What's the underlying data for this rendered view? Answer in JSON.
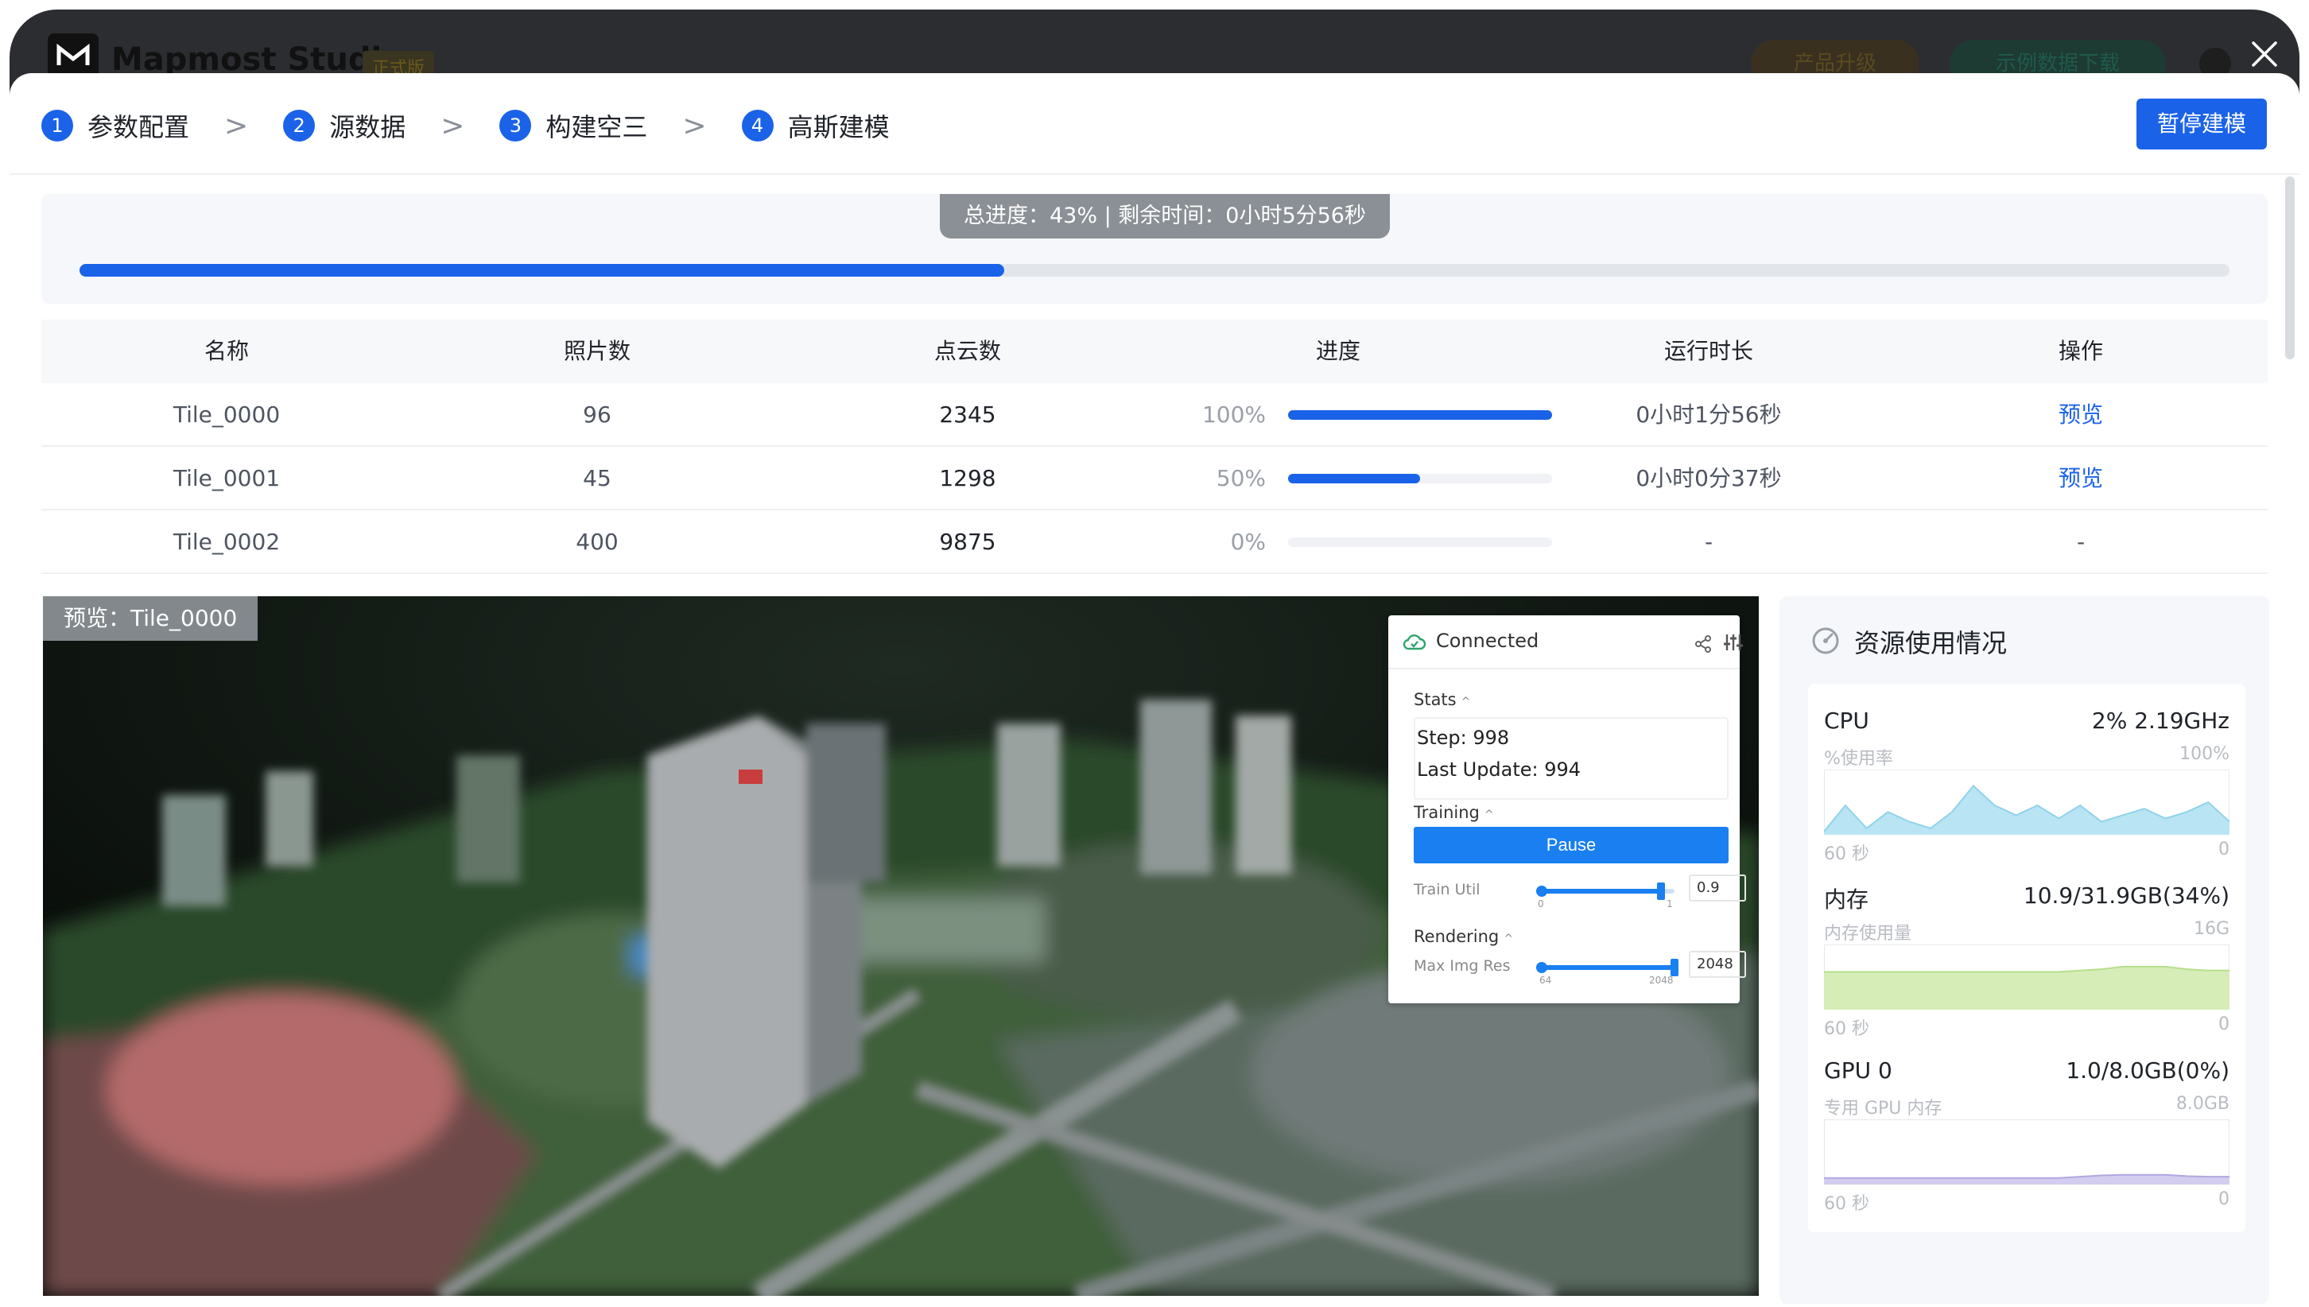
{
  "app": {
    "name": "Mapmost Studio",
    "edition_badge": "正式版",
    "upgrade_label": "产品升级",
    "sample_label": "示例数据下载"
  },
  "steps": [
    {
      "num": "1",
      "label": "参数配置"
    },
    {
      "num": "2",
      "label": "源数据"
    },
    {
      "num": "3",
      "label": "构建空三"
    },
    {
      "num": "4",
      "label": "高斯建模"
    }
  ],
  "step_separator": ">",
  "pause_button": "暂停建模",
  "progress": {
    "label": "总进度：43% | 剩余时间：0小时5分56秒",
    "fraction": 0.43
  },
  "table": {
    "headers": [
      "名称",
      "照片数",
      "点云数",
      "进度",
      "运行时长",
      "操作"
    ],
    "rows": [
      {
        "name": "Tile_0000",
        "photos": "96",
        "points": "2345",
        "progress": "100%",
        "progress_value": 1.0,
        "duration": "0小时1分56秒",
        "action": "预览"
      },
      {
        "name": "Tile_0001",
        "photos": "45",
        "points": "1298",
        "progress": "50%",
        "progress_value": 0.5,
        "duration": "0小时0分37秒",
        "action": "预览"
      },
      {
        "name": "Tile_0002",
        "photos": "400",
        "points": "9875",
        "progress": "0%",
        "progress_value": 0.0,
        "duration": "-",
        "action": "-"
      }
    ]
  },
  "preview": {
    "tag": "预览：Tile_0000",
    "panel": {
      "status": "Connected",
      "stats_title": "Stats",
      "step": "Step: 998",
      "last_update": "Last Update: 994",
      "training_title": "Training",
      "pause_label": "Pause",
      "train_util_label": "Train Util",
      "train_util_min": "0",
      "train_util_max": "1",
      "train_util_value": "0.9",
      "train_util_fraction": 0.9,
      "rendering_title": "Rendering",
      "max_img_res_label": "Max Img Res",
      "max_img_res_min": "64",
      "max_img_res_max": "2048",
      "max_img_res_value": "2048",
      "max_img_res_fraction": 1.0
    }
  },
  "resources": {
    "title": "资源使用情况",
    "metrics": [
      {
        "name": "CPU",
        "value": "2% 2.19GHz",
        "sub": "%使用率",
        "max": "100%",
        "time": "60 秒",
        "zero": "0",
        "color": "#8fd3ea",
        "fill": "#b9e4f3",
        "series": [
          0.05,
          0.45,
          0.1,
          0.35,
          0.2,
          0.1,
          0.35,
          0.75,
          0.45,
          0.3,
          0.45,
          0.25,
          0.45,
          0.2,
          0.3,
          0.4,
          0.25,
          0.35,
          0.5,
          0.2
        ]
      },
      {
        "name": "内存",
        "value": "10.9/31.9GB(34%)",
        "sub": "内存使用量",
        "max": "16G",
        "time": "60 秒",
        "zero": "0",
        "color": "#b7de8a",
        "fill": "#d6edb8",
        "series": [
          0.58,
          0.58,
          0.58,
          0.58,
          0.58,
          0.58,
          0.58,
          0.58,
          0.58,
          0.58,
          0.58,
          0.58,
          0.6,
          0.62,
          0.66,
          0.66,
          0.66,
          0.62,
          0.6,
          0.6
        ]
      },
      {
        "name": "GPU 0",
        "value": "1.0/8.0GB(0%)",
        "sub": "专用 GPU 内存",
        "max": "8.0GB",
        "time": "60 秒",
        "zero": "0",
        "color": "#b3a6e0",
        "fill": "#d3cdef",
        "series": [
          0.1,
          0.1,
          0.1,
          0.1,
          0.1,
          0.1,
          0.1,
          0.1,
          0.1,
          0.1,
          0.1,
          0.1,
          0.12,
          0.14,
          0.15,
          0.15,
          0.15,
          0.13,
          0.12,
          0.12
        ]
      }
    ]
  }
}
